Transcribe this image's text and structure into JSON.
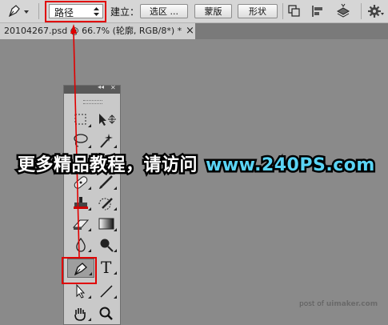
{
  "options_bar": {
    "mode_select_value": "路径",
    "build_label": "建立：",
    "selection_button": "选区 ...",
    "mask_button": "蒙版",
    "shape_button": "形状"
  },
  "document_tab": {
    "title": "20104267.psd @ 66.7% (轮廓, RGB/8*) *",
    "close_glyph": "×"
  },
  "tools_panel": {
    "collapse_glyph": "◂◂",
    "close_glyph": "✕",
    "text_tool_glyph": "T",
    "tools": [
      "rectangular-marquee",
      "move",
      "lasso",
      "magic-wand",
      "crop",
      "eyedropper",
      "healing-brush",
      "brush",
      "clone-stamp",
      "history-brush",
      "eraser",
      "gradient",
      "blur",
      "dodge",
      "pen",
      "type",
      "path-selection",
      "line",
      "hand",
      "zoom"
    ],
    "active_tool": "pen"
  },
  "watermark": {
    "chinese": "更多精品教程，请访问",
    "url": "www.240PS.com"
  },
  "credit": {
    "prefix": "post of ",
    "site": "uimaker.com"
  },
  "colors": {
    "annotation_red": "#e00000",
    "watermark_blue": "#5ad4f5",
    "canvas_gray": "#8a8a8a"
  }
}
